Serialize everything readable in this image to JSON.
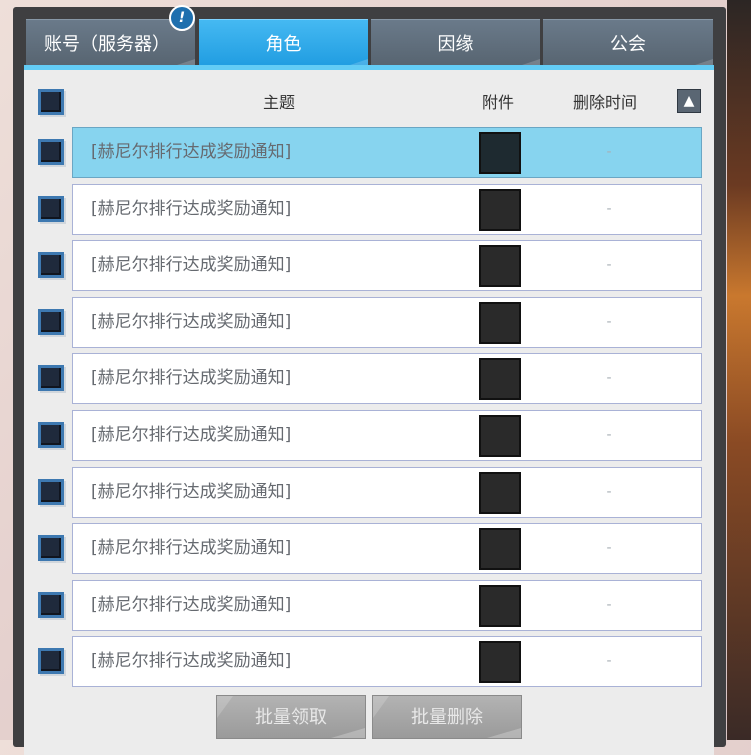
{
  "tabs": [
    {
      "label": "账号（服务器）",
      "active": false
    },
    {
      "label": "角色",
      "active": true
    },
    {
      "label": "因缘",
      "active": false
    },
    {
      "label": "公会",
      "active": false
    }
  ],
  "badge": "!",
  "columns": {
    "subject": "主题",
    "attachment": "附件",
    "delete_time": "删除时间"
  },
  "sort_icon": "▲",
  "rows": [
    {
      "subject": "[赫尼尔排行达成奖励通知]",
      "delete_time": "-"
    },
    {
      "subject": "[赫尼尔排行达成奖励通知]",
      "delete_time": "-"
    },
    {
      "subject": "[赫尼尔排行达成奖励通知]",
      "delete_time": "-"
    },
    {
      "subject": "[赫尼尔排行达成奖励通知]",
      "delete_time": "-"
    },
    {
      "subject": "[赫尼尔排行达成奖励通知]",
      "delete_time": "-"
    },
    {
      "subject": "[赫尼尔排行达成奖励通知]",
      "delete_time": "-"
    },
    {
      "subject": "[赫尼尔排行达成奖励通知]",
      "delete_time": "-"
    },
    {
      "subject": "[赫尼尔排行达成奖励通知]",
      "delete_time": "-"
    },
    {
      "subject": "[赫尼尔排行达成奖励通知]",
      "delete_time": "-"
    },
    {
      "subject": "[赫尼尔排行达成奖励通知]",
      "delete_time": "-"
    }
  ],
  "buttons": {
    "batch_receive": "批量领取",
    "batch_delete": "批量删除"
  },
  "colors": {
    "active_tab": "#1e9be0",
    "selected_row": "#87d4ef",
    "panel": "#3f3f41"
  }
}
